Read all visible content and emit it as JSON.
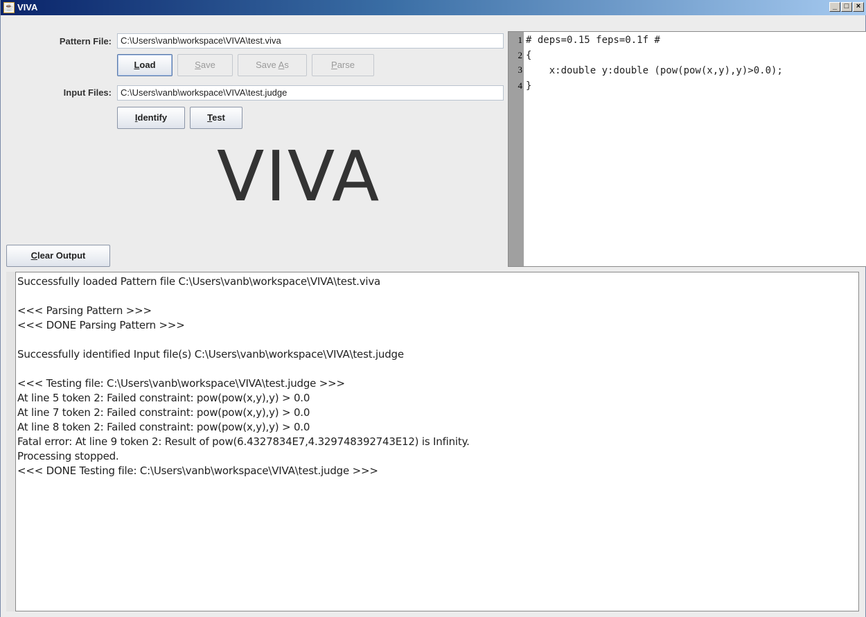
{
  "window": {
    "title": "VIVA"
  },
  "pattern_label": "Pattern File:",
  "pattern_value": "C:\\Users\\vanb\\workspace\\VIVA\\test.viva",
  "input_label": "Input Files:",
  "input_value": "C:\\Users\\vanb\\workspace\\VIVA\\test.judge",
  "buttons": {
    "load": {
      "m": "L",
      "r": "oad"
    },
    "save": {
      "m": "S",
      "r": "ave"
    },
    "saveas": {
      "a": "Save ",
      "m": "A",
      "r": "s"
    },
    "parse": {
      "m": "P",
      "r": "arse"
    },
    "identify": {
      "m": "I",
      "r": "dentify"
    },
    "test": {
      "m": "T",
      "r": "est"
    },
    "clear": {
      "m": "C",
      "r": "lear Output"
    }
  },
  "logo_text": "VIVA",
  "editor": {
    "line_numbers": [
      "1",
      "2",
      "3",
      "4"
    ],
    "lines": [
      "# deps=0.15 feps=0.1f #",
      "{",
      "    x:double y:double (pow(pow(x,y),y)>0.0);",
      "}"
    ]
  },
  "output_lines": [
    "Successfully loaded Pattern file C:\\Users\\vanb\\workspace\\VIVA\\test.viva",
    "",
    "<<< Parsing Pattern >>>",
    "<<< DONE Parsing Pattern >>>",
    "",
    "Successfully identified Input file(s) C:\\Users\\vanb\\workspace\\VIVA\\test.judge",
    "",
    "<<< Testing file: C:\\Users\\vanb\\workspace\\VIVA\\test.judge >>>",
    "At line 5 token 2: Failed constraint: pow(pow(x,y),y) > 0.0",
    "At line 7 token 2: Failed constraint: pow(pow(x,y),y) > 0.0",
    "At line 8 token 2: Failed constraint: pow(pow(x,y),y) > 0.0",
    "Fatal error: At line 9 token 2: Result of pow(6.4327834E7,4.329748392743E12) is Infinity.",
    "Processing stopped.",
    "<<< DONE Testing file: C:\\Users\\vanb\\workspace\\VIVA\\test.judge >>>"
  ]
}
